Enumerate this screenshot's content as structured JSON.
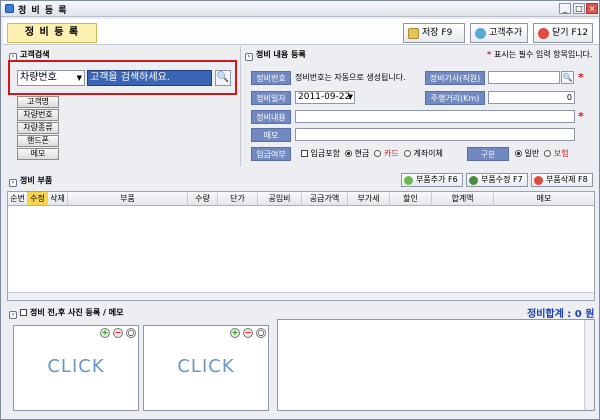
{
  "window": {
    "title": "정 비 등 록"
  },
  "header": {
    "page_tab": "정 비 등 록",
    "save": "저장 F9",
    "add_customer": "고객추가",
    "close": "닫기 F12"
  },
  "customer": {
    "section": "고객검색",
    "search_type": "차량번호",
    "search_placeholder": "고객을 검색하세요.",
    "fields": [
      "고객명",
      "차량번호",
      "차량종류",
      "핸드폰",
      "메모"
    ]
  },
  "repair": {
    "section": "정비 내용 등록",
    "required_note": "표시는 필수 입력 항목입니다.",
    "no_label": "정비번호",
    "no_value": "정비번호는 자동으로 생성됩니다.",
    "mechanic_label": "정비기사(직원)",
    "mechanic_value": "",
    "date_label": "정비일자",
    "date_value": "2011-09-22",
    "mileage_label": "주행거리(Km)",
    "mileage_value": "0",
    "content_label": "정비내용",
    "content_value": "",
    "memo_label": "메모",
    "memo_value": "",
    "payment_label": "입금여부",
    "payment_include": "입금포함",
    "payment_options": [
      "현금",
      "카드",
      "계좌이체"
    ],
    "payment_selected": "현금",
    "type_label": "구분",
    "type_options": [
      "일반",
      "보험"
    ],
    "type_selected": "일반"
  },
  "parts": {
    "section": "정비 부품",
    "add": "부품추가 F6",
    "edit": "부품수정 F7",
    "delete": "부품삭제 F8",
    "columns": [
      "순번",
      "수정",
      "삭제",
      "부품",
      "수량",
      "단가",
      "공임비",
      "공급가액",
      "부가세",
      "할인",
      "합계액",
      "메모"
    ],
    "rows": []
  },
  "photos": {
    "section": "정비 전,후 사진 등록 / 메모",
    "total": "정비합계 : 0 원",
    "click": "CLICK"
  },
  "colors": {
    "label_bg": "#7288c0",
    "highlight": "#d01818",
    "accent": "#1d3fae"
  }
}
